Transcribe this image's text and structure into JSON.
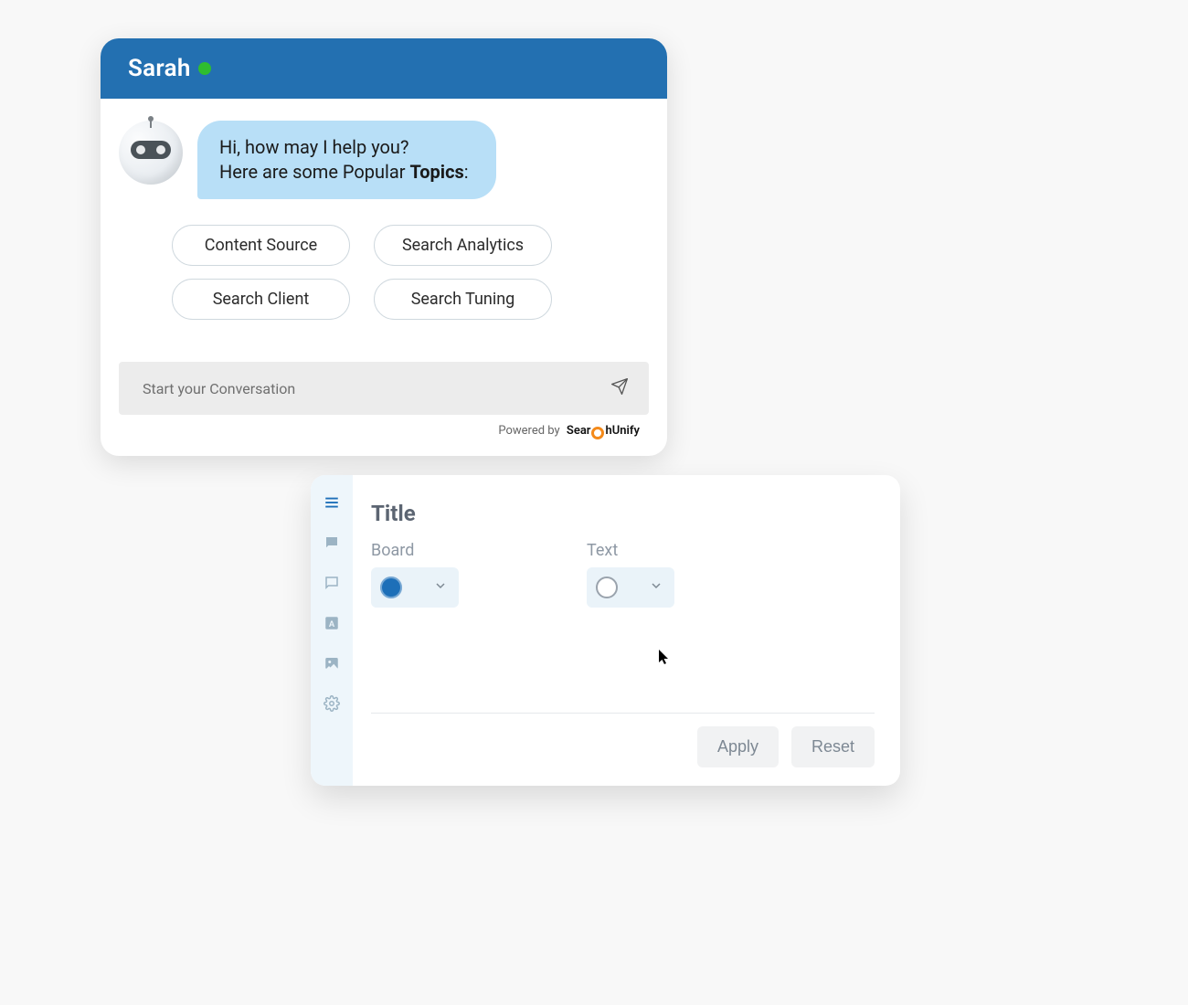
{
  "chat": {
    "agent_name": "Sarah",
    "message": {
      "line1": "Hi, how may I help you?",
      "line2_prefix": "Here are some Popular ",
      "line2_bold": "Topics",
      "line2_suffix": ":"
    },
    "topics": [
      "Content Source",
      "Search Analytics",
      "Search Client",
      "Search Tuning"
    ],
    "input_placeholder": "Start your Conversation",
    "powered_prefix": "Powered by",
    "brand_part1": "Sear",
    "brand_part2": "hUnify"
  },
  "settings": {
    "title": "Title",
    "board_label": "Board",
    "text_label": "Text",
    "board_color": "#1d6fb8",
    "text_color": "#ffffff",
    "apply_label": "Apply",
    "reset_label": "Reset"
  }
}
